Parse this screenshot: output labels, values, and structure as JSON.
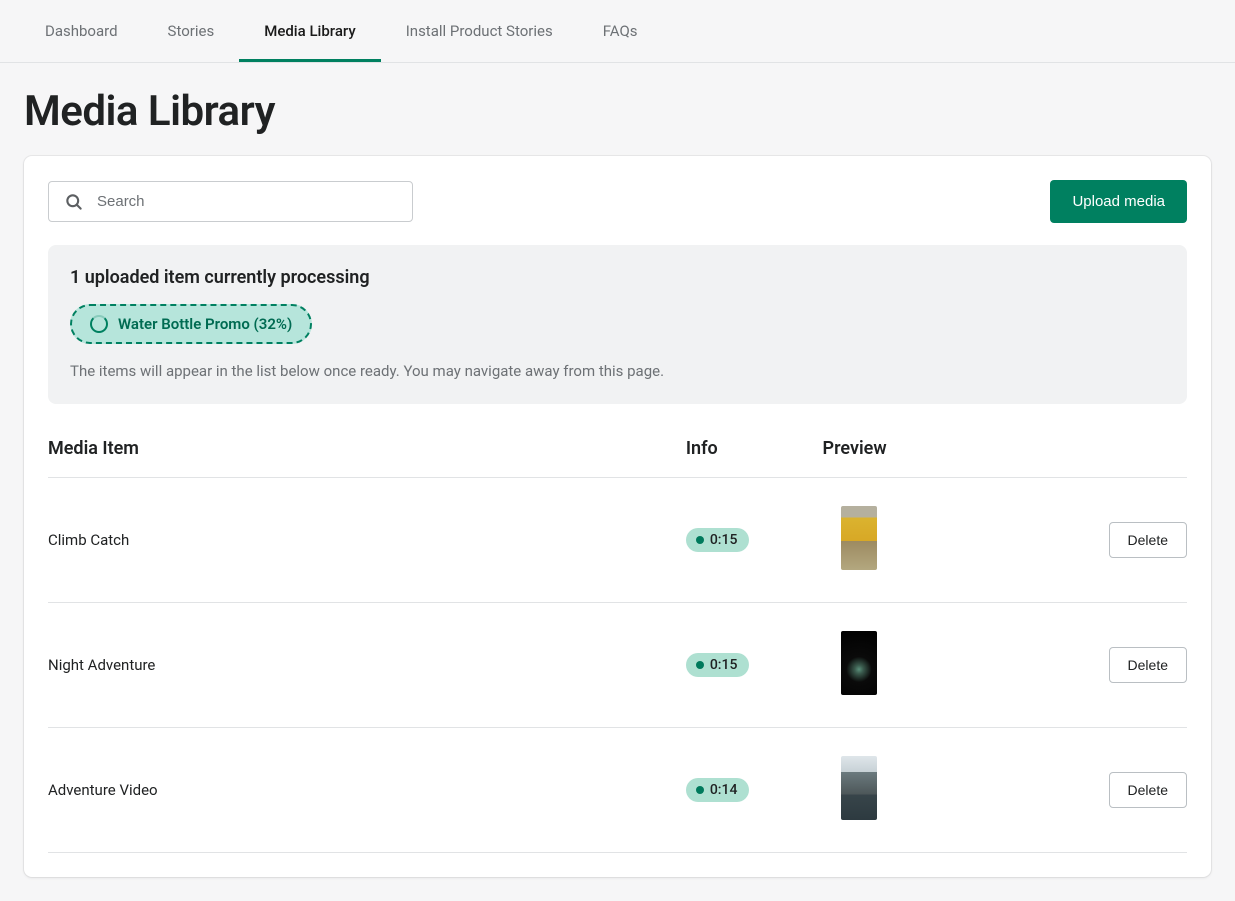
{
  "nav": {
    "items": [
      {
        "label": "Dashboard"
      },
      {
        "label": "Stories"
      },
      {
        "label": "Media Library"
      },
      {
        "label": "Install Product Stories"
      },
      {
        "label": "FAQs"
      }
    ],
    "active_index": 2
  },
  "page": {
    "title": "Media Library"
  },
  "search": {
    "placeholder": "Search",
    "value": ""
  },
  "upload_button": {
    "label": "Upload media"
  },
  "processing": {
    "title": "1 uploaded item currently processing",
    "items": [
      {
        "name": "Water Bottle Promo",
        "percent": 32
      }
    ],
    "pill_text": "Water Bottle Promo (32%)",
    "note": "The items will appear in the list below once ready. You may navigate away from this page."
  },
  "table": {
    "headers": {
      "name": "Media Item",
      "info": "Info",
      "preview": "Preview"
    },
    "delete_label": "Delete",
    "rows": [
      {
        "name": "Climb Catch",
        "duration": "0:15",
        "thumb_class": "thumb-1"
      },
      {
        "name": "Night Adventure",
        "duration": "0:15",
        "thumb_class": "thumb-2"
      },
      {
        "name": "Adventure Video",
        "duration": "0:14",
        "thumb_class": "thumb-3"
      }
    ]
  }
}
